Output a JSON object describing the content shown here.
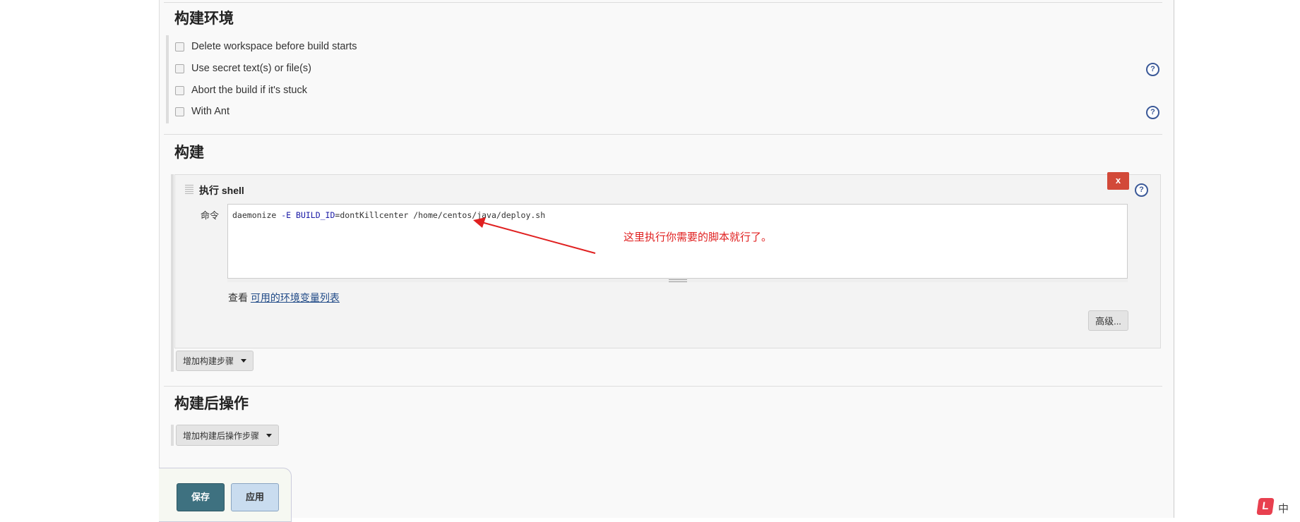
{
  "build_env": {
    "title": "构建环境",
    "options": [
      {
        "label": "Delete workspace before build starts",
        "checked": false,
        "help": false
      },
      {
        "label": "Use secret text(s) or file(s)",
        "checked": false,
        "help": true
      },
      {
        "label": "Abort the build if it's stuck",
        "checked": false,
        "help": false
      },
      {
        "label": "With Ant",
        "checked": false,
        "help": true
      }
    ]
  },
  "build": {
    "title": "构建",
    "step": {
      "title": "执行 shell",
      "delete_label": "x",
      "command_label": "命令",
      "command": {
        "p1": "daemonize ",
        "p2": "-E BUILD_ID",
        "p3": "=dontKillcenter /home/centos/java/deploy.sh"
      },
      "see_prefix": "查看",
      "env_link": "可用的环境变量列表",
      "advanced_label": "高级..."
    },
    "add_step_label": "增加构建步骤"
  },
  "annotation": {
    "text": "这里执行你需要的脚本就行了。",
    "color": "#e02020"
  },
  "post_build": {
    "title": "构建后操作",
    "add_step_label": "增加构建后操作步骤"
  },
  "footer": {
    "save_label": "保存",
    "apply_label": "应用"
  },
  "ime": {
    "label": "中"
  },
  "colors": {
    "save": "#3e7180",
    "apply": "#c9dcef",
    "delete": "#d24939",
    "help": "#3b5998"
  }
}
